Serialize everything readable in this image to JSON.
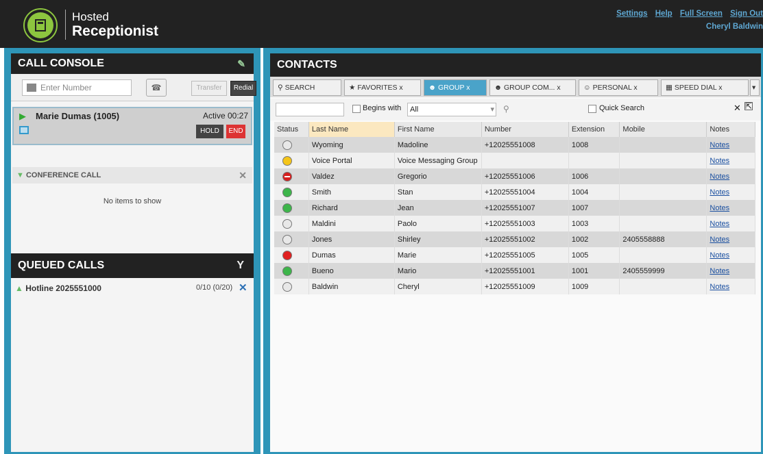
{
  "app": {
    "title1": "Hosted",
    "title2": "Receptionist",
    "links": [
      "Settings",
      "Help",
      "Full Screen",
      "Sign Out"
    ],
    "user": "Cheryl Baldwin"
  },
  "callConsole": {
    "title": "CALL CONSOLE",
    "placeholder": "Enter Number",
    "transfer": "Transfer",
    "redial": "Redial",
    "activeCall": {
      "name": "Marie Dumas (1005)",
      "status": "Active 00:27",
      "hold": "HOLD",
      "end": "END"
    },
    "conferenceTitle": "CONFERENCE CALL",
    "noItems": "No items to show"
  },
  "queued": {
    "title": "QUEUED CALLS",
    "hotline": "Hotline 2025551000",
    "count": "0/10 (0/20)"
  },
  "contacts": {
    "title": "CONTACTS",
    "tabs": [
      "SEARCH",
      "FAVORITES",
      "GROUP",
      "GROUP COM...",
      "PERSONAL",
      "SPEED DIAL"
    ],
    "filter": {
      "beginsWith": "Begins with",
      "option": "All",
      "quickSearch": "Quick Search"
    },
    "columns": [
      "Status",
      "Last Name",
      "First Name",
      "Number",
      "Extension",
      "Mobile",
      "Notes"
    ],
    "rows": [
      {
        "status": "grey",
        "last": "Wyoming",
        "first": "Madoline",
        "number": "+12025551008",
        "ext": "1008",
        "mobile": "",
        "notes": "Notes"
      },
      {
        "status": "yellow",
        "last": "Voice Portal",
        "first": "Voice Messaging Group",
        "number": "",
        "ext": "",
        "mobile": "",
        "notes": "Notes"
      },
      {
        "status": "dnd",
        "last": "Valdez",
        "first": "Gregorio",
        "number": "+12025551006",
        "ext": "1006",
        "mobile": "",
        "notes": "Notes"
      },
      {
        "status": "green",
        "last": "Smith",
        "first": "Stan",
        "number": "+12025551004",
        "ext": "1004",
        "mobile": "",
        "notes": "Notes"
      },
      {
        "status": "green",
        "last": "Richard",
        "first": "Jean",
        "number": "+12025551007",
        "ext": "1007",
        "mobile": "",
        "notes": "Notes"
      },
      {
        "status": "grey",
        "last": "Maldini",
        "first": "Paolo",
        "number": "+12025551003",
        "ext": "1003",
        "mobile": "",
        "notes": "Notes"
      },
      {
        "status": "grey",
        "last": "Jones",
        "first": "Shirley",
        "number": "+12025551002",
        "ext": "1002",
        "mobile": "2405558888",
        "notes": "Notes"
      },
      {
        "status": "red",
        "last": "Dumas",
        "first": "Marie",
        "number": "+12025551005",
        "ext": "1005",
        "mobile": "",
        "notes": "Notes"
      },
      {
        "status": "green",
        "last": "Bueno",
        "first": "Mario",
        "number": "+12025551001",
        "ext": "1001",
        "mobile": "2405559999",
        "notes": "Notes"
      },
      {
        "status": "grey",
        "last": "Baldwin",
        "first": "Cheryl",
        "number": "+12025551009",
        "ext": "1009",
        "mobile": "",
        "notes": "Notes"
      }
    ]
  }
}
